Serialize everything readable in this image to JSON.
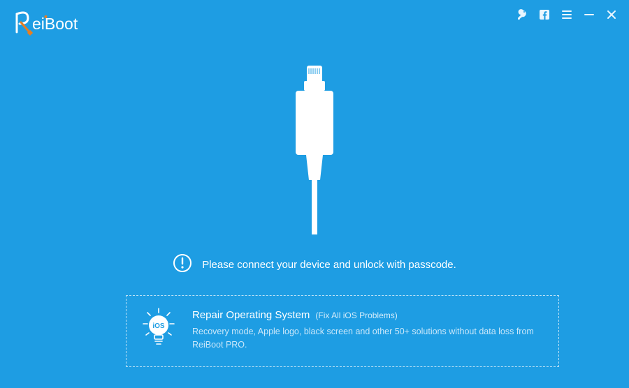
{
  "app": {
    "name": "ReiBoot"
  },
  "status": {
    "message": "Please connect your device and unlock with passcode."
  },
  "repair": {
    "title": "Repair Operating System",
    "subtitle": "(Fix All iOS Problems)",
    "description": "Recovery mode, Apple logo, black screen and other 50+ solutions without data loss from ReiBoot PRO.",
    "badge": "iOS"
  },
  "icons": {
    "key": "key-icon",
    "facebook": "facebook-icon",
    "menu": "menu-icon",
    "minimize": "minimize-icon",
    "close": "close-icon",
    "alert": "alert-icon",
    "bulb": "lightbulb-ios-icon",
    "cable": "lightning-cable-icon"
  }
}
